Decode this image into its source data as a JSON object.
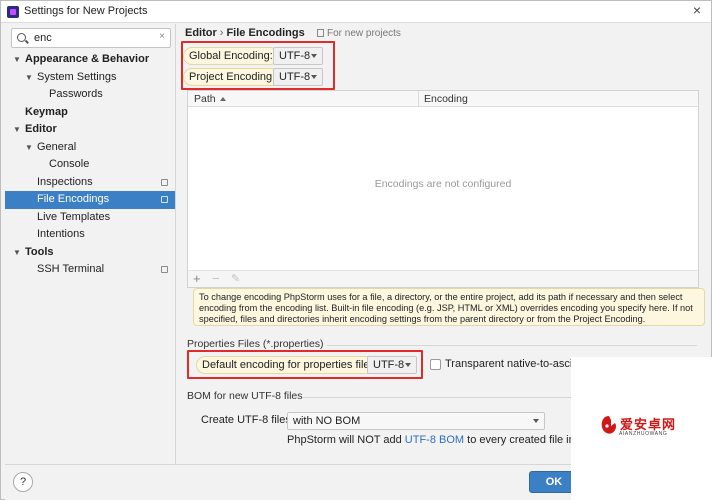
{
  "window": {
    "title": "Settings for New Projects",
    "close_glyph": "×"
  },
  "search": {
    "value": "enc",
    "clear_glyph": "×"
  },
  "tree": [
    {
      "label": "Appearance & Behavior",
      "level": 0,
      "bold": true,
      "expanded": true
    },
    {
      "label": "System Settings",
      "level": 1,
      "bold": false,
      "expanded": true
    },
    {
      "label": "Passwords",
      "level": 2,
      "bold": false
    },
    {
      "label": "Keymap",
      "level": 0,
      "bold": true
    },
    {
      "label": "Editor",
      "level": 0,
      "bold": true,
      "expanded": true
    },
    {
      "label": "General",
      "level": 1,
      "bold": false,
      "expanded": true
    },
    {
      "label": "Console",
      "level": 2,
      "bold": false
    },
    {
      "label": "Inspections",
      "level": 1,
      "bold": false,
      "tag": true
    },
    {
      "label": "File Encodings",
      "level": 1,
      "bold": false,
      "tag": true,
      "selected": true
    },
    {
      "label": "Live Templates",
      "level": 1,
      "bold": false
    },
    {
      "label": "Intentions",
      "level": 1,
      "bold": false
    },
    {
      "label": "Tools",
      "level": 0,
      "bold": true,
      "expanded": true
    },
    {
      "label": "SSH Terminal",
      "level": 1,
      "bold": false,
      "tag": true
    }
  ],
  "breadcrumb": {
    "parent": "Editor",
    "separator": "›",
    "current": "File Encodings",
    "scope": "For new projects"
  },
  "global_encoding": {
    "label": "Global Encoding:",
    "value": "UTF-8"
  },
  "project_encoding": {
    "label": "Project Encoding:",
    "value": "UTF-8"
  },
  "table": {
    "col_path": "Path",
    "col_encoding": "Encoding",
    "empty_text": "Encodings are not configured"
  },
  "toolbar": {
    "add": "+",
    "remove": "−",
    "edit": "✎"
  },
  "help_text": "To change encoding PhpStorm uses for a file, a directory, or the entire project, add its path if necessary and then select encoding from the encoding list. Built-in file encoding (e.g. JSP, HTML or XML) overrides encoding you specify here. If not specified, files and directories inherit encoding settings from the parent directory or from the Project Encoding.",
  "properties": {
    "section": "Properties Files (*.properties)",
    "default_label": "Default encoding for properties files:",
    "default_value": "UTF-8",
    "transparent_label": "Transparent native-to-ascii co"
  },
  "bom": {
    "section": "BOM for new UTF-8 files",
    "create_label": "Create UTF-8 files:",
    "create_value": "with NO BOM",
    "note_prefix": "PhpStorm will NOT add ",
    "note_link": "UTF-8 BOM",
    "note_suffix": " to every created file in UTF-8"
  },
  "buttons": {
    "help": "?",
    "ok": "OK"
  },
  "watermark": {
    "text": "爱安卓网",
    "sub": "AIANZHUOWANG"
  },
  "colors": {
    "accent": "#3b7fc4",
    "highlight": "#e02b2b",
    "tooltip": "#fcf7de"
  }
}
